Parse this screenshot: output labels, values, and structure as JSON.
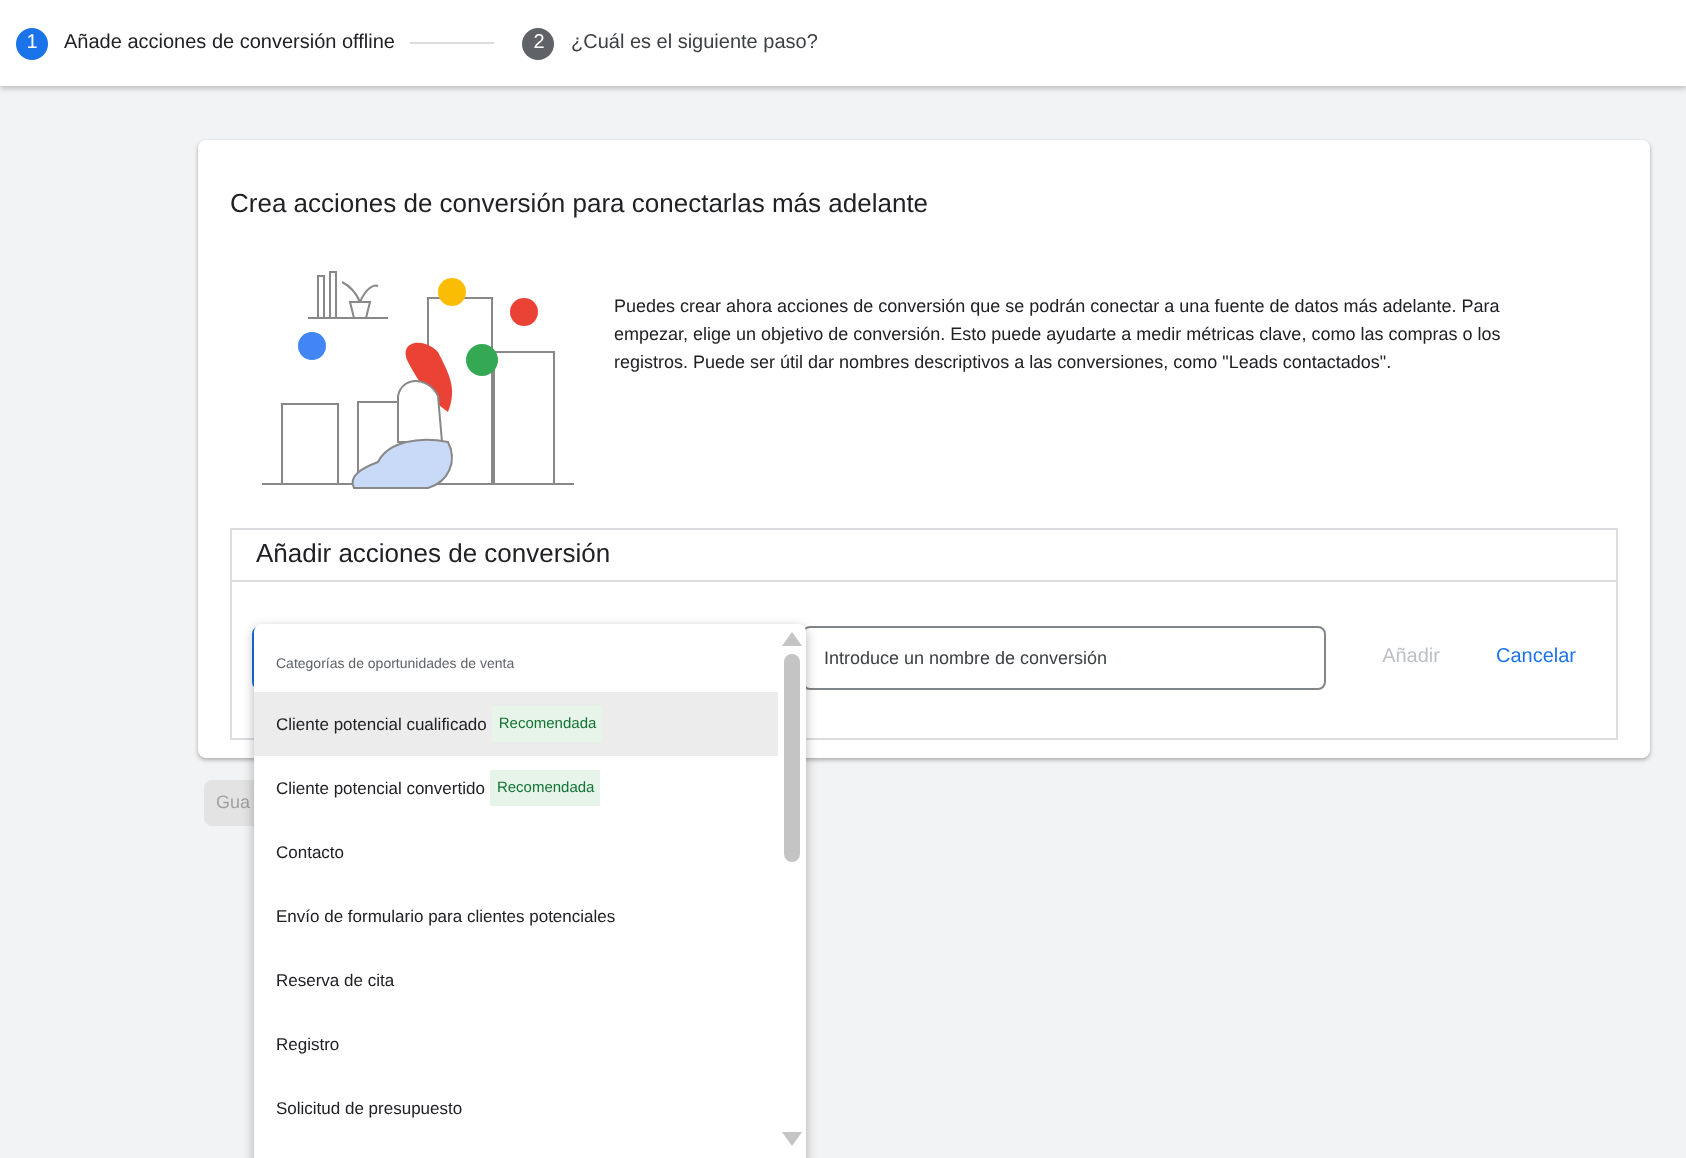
{
  "stepper": [
    {
      "number": "1",
      "label": "Añade acciones de conversión offline",
      "selected": true
    },
    {
      "number": "2",
      "label": "¿Cuál es el siguiente paso?",
      "selected": false
    }
  ],
  "card": {
    "title": "Crea acciones de conversión para conectarlas más adelante",
    "description": "Puedes crear ahora acciones de conversión que se podrán conectar a una fuente de datos más adelante. Para empezar, elige un objetivo de conversión. Esto puede ayudarte a medir métricas clave, como las compras o los registros. Puede ser útil dar nombres descriptivos a las conversiones, como \"Leads contactados\".",
    "section": {
      "title": "Añadir acciones de conversión",
      "name_field": {
        "placeholder": "Introduce un nombre de conversión"
      },
      "buttons": [
        {
          "label": "Añadir",
          "disabled": true
        },
        {
          "label": "Cancelar",
          "disabled": false
        }
      ]
    }
  },
  "save_button": {
    "label": "Gua",
    "disabled": true
  },
  "dropdown": {
    "group_label": "Categorías de oportunidades de venta",
    "items": [
      {
        "label": "Cliente potencial cualificado",
        "badge": "Recomendada",
        "selected": true
      },
      {
        "label": "Cliente potencial convertido",
        "badge": "Recomendada",
        "selected": false
      },
      {
        "label": "Contacto",
        "selected": false
      },
      {
        "label": "Envío de formulario para clientes potenciales",
        "selected": false
      },
      {
        "label": "Reserva de cita",
        "selected": false
      },
      {
        "label": "Registro",
        "selected": false
      },
      {
        "label": "Solicitud de presupuesto",
        "selected": false
      }
    ]
  }
}
